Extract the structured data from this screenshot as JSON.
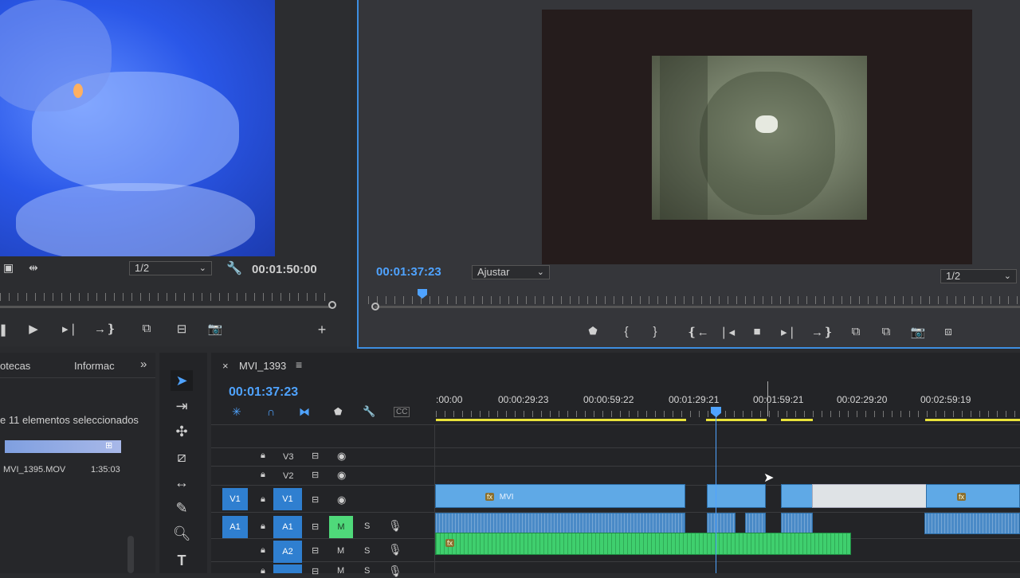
{
  "source_monitor": {
    "resolution": "1/2",
    "timecode": "00:01:50:00"
  },
  "program_monitor": {
    "timecode": "00:01:37:23",
    "fit": "Ajustar",
    "resolution": "1/2"
  },
  "project_panel": {
    "tabs": [
      "otecas",
      "Informac"
    ],
    "status": "e 11 elementos seleccionados",
    "item": {
      "name": "MVI_1395.MOV",
      "duration": "1:35:03"
    }
  },
  "timeline": {
    "sequence_name": "MVI_1393",
    "timecode": "00:01:37:23",
    "ruler": [
      ":00:00",
      "00:00:29:23",
      "00:00:59:22",
      "00:01:29:21",
      "00:01:59:21",
      "00:02:29:20",
      "00:02:59:19"
    ],
    "tracks": {
      "v3": "V3",
      "v2": "V2",
      "v1": "V1",
      "v1_src": "V1",
      "a1": "A1",
      "a1_src": "A1",
      "a2": "A2"
    },
    "clip_label": "MVI",
    "mute": "M",
    "solo": "S",
    "cc": "CC"
  },
  "colors": {
    "accent": "#4fa3ff",
    "video_clip": "#5fa9e6",
    "audio_clip_green": "#3fcf6e",
    "work_area": "#e9e23a"
  }
}
